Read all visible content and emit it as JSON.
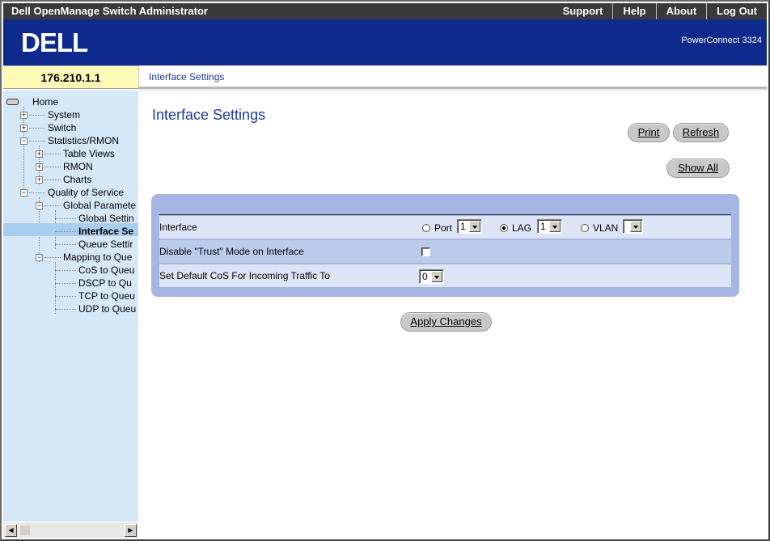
{
  "app": {
    "title": "Dell OpenManage Switch Administrator",
    "links": [
      "Support",
      "Help",
      "About",
      "Log Out"
    ],
    "brand": "DELL",
    "model": "PowerConnect 3324"
  },
  "address": "176.210.1.1",
  "breadcrumb": "Interface Settings",
  "sidebar": {
    "home": "Home",
    "system": "System",
    "switch": "Switch",
    "statistics": "Statistics/RMON",
    "table_views": "Table Views",
    "rmon": "RMON",
    "charts": "Charts",
    "qos": "Quality of Service",
    "global_parameters": "Global Paramete",
    "global_settings": "Global Settin",
    "interface_settings": "Interface Se",
    "queue_settings": "Queue Settir",
    "mapping": "Mapping to Que",
    "cos": "CoS to Queu",
    "dscp": "DSCP to Qu",
    "tcp": "TCP to Queu",
    "udp": "UDP to Queu"
  },
  "main": {
    "title": "Interface Settings",
    "print_label": "Print",
    "refresh_label": "Refresh",
    "show_all_label": "Show All",
    "apply_label": "Apply Changes",
    "form": {
      "interface_label": "Interface",
      "port_label": "Port",
      "port_value": "1",
      "lag_label": "LAG",
      "lag_value": "1",
      "vlan_label": "VLAN",
      "vlan_value": "",
      "selected": "LAG",
      "trust_label": "Disable \"Trust\" Mode on Interface",
      "trust_checked": false,
      "cos_label": "Set Default CoS For Incoming Traffic To",
      "cos_value": "0"
    }
  },
  "colors": {
    "banner": "#0d2a8c",
    "sidebar": "#d6e7f8",
    "accent_text": "#1a3aa6",
    "panel": "#a6b5e2",
    "ip_box": "#fdf9b6"
  }
}
